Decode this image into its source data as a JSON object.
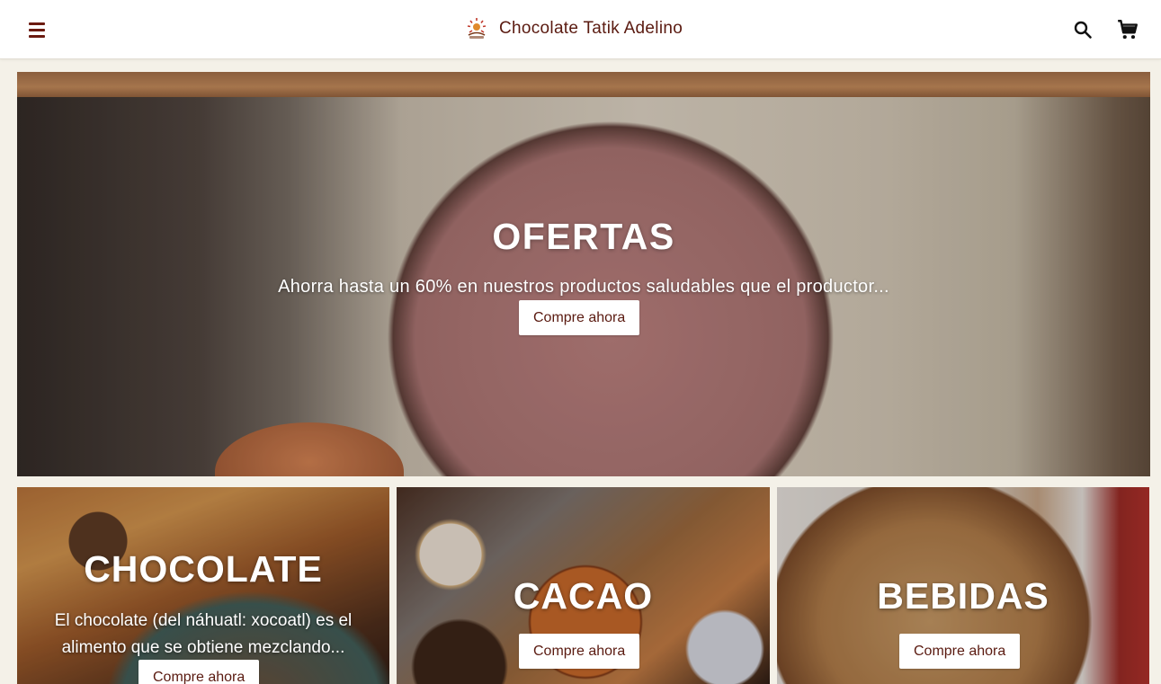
{
  "header": {
    "menu_icon": "hamburger-menu-icon",
    "title": "Chocolate Tatik Adelino",
    "search_icon": "search-icon",
    "cart_icon": "shopping-cart-icon",
    "brand_color": "#5a1a10"
  },
  "hero": {
    "title": "OFERTAS",
    "subtitle": "Ahorra hasta un 60% en nuestros productos saludables que el productor...",
    "button_label": "Compre ahora"
  },
  "categories": [
    {
      "title": "CHOCOLATE",
      "description": "El chocolate (del náhuatl: xocoatl) es el alimento que se obtiene mezclando...",
      "button_label": "Compre ahora"
    },
    {
      "title": "CACAO",
      "button_label": "Compre ahora"
    },
    {
      "title": "BEBIDAS",
      "button_label": "Compre ahora"
    }
  ],
  "colors": {
    "page_background": "#f4f1e8",
    "accent": "#5a1a10"
  }
}
